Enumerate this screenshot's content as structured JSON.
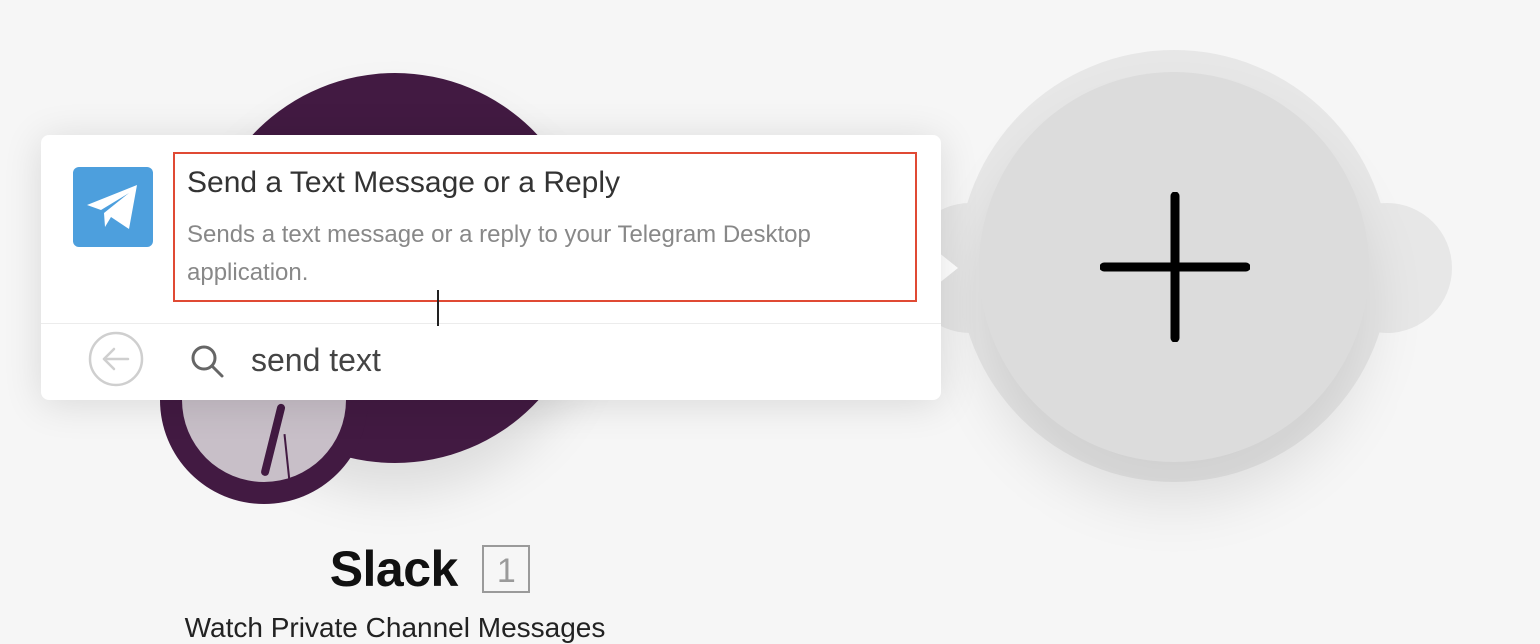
{
  "canvas": {
    "module": {
      "app_name": "Slack",
      "index": "1",
      "subtitle": "Watch Private Channel Messages",
      "color": "#421a42"
    },
    "add_module": {
      "icon": "plus-icon"
    }
  },
  "popup": {
    "result": {
      "icon": "telegram-icon",
      "icon_color": "#4d9fdd",
      "title": "Send a Text Message or a Reply",
      "description": "Sends a text message or a reply to your Telegram Desktop application.",
      "highlight_color": "#e04a34"
    },
    "search": {
      "back_icon": "back-arrow-icon",
      "search_icon": "search-icon",
      "value": "send text"
    }
  }
}
